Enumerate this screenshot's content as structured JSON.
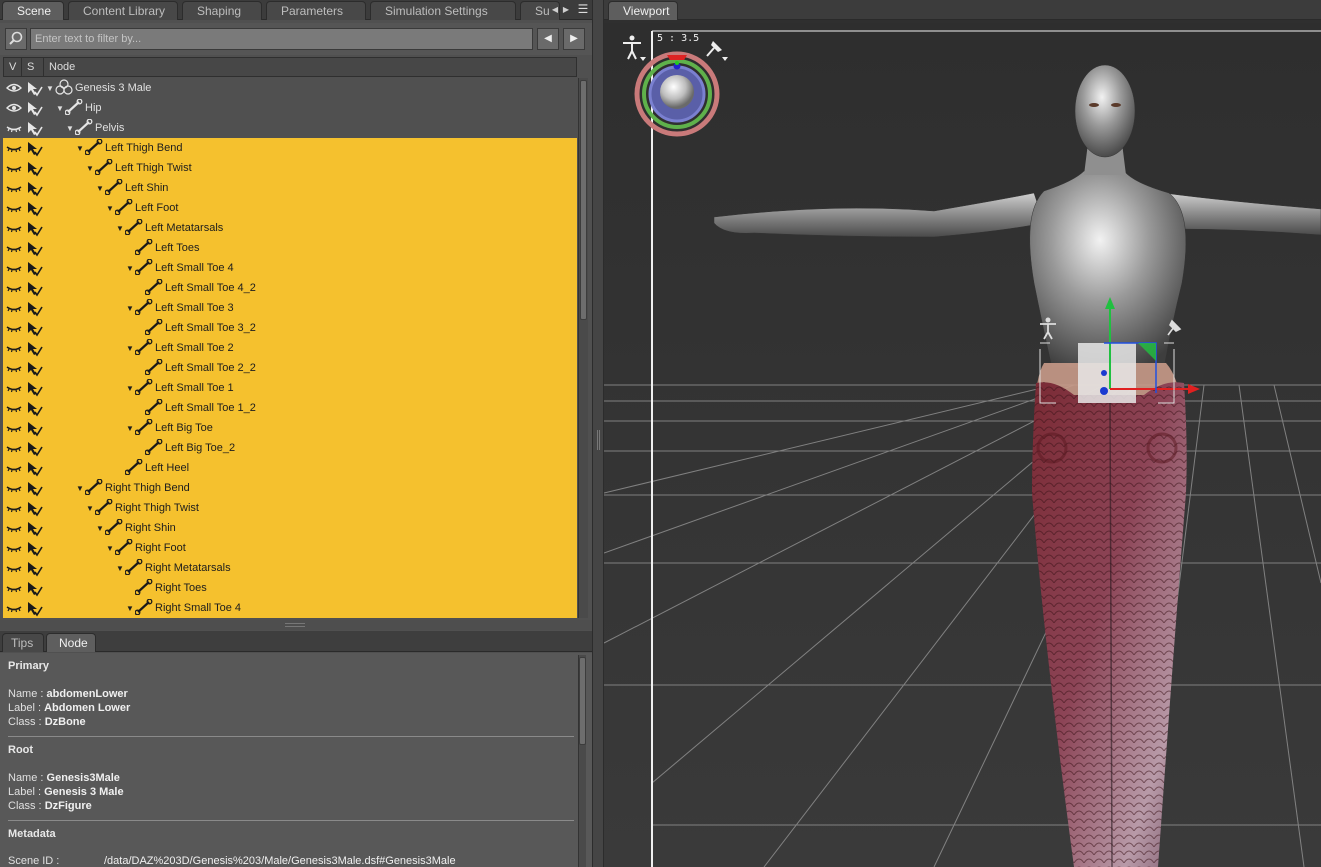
{
  "scene_tabs": [
    {
      "label": "Scene",
      "active": true
    },
    {
      "label": "Content Library",
      "active": false
    },
    {
      "label": "Shaping",
      "active": false
    },
    {
      "label": "Parameters",
      "active": false
    },
    {
      "label": "Simulation Settings",
      "active": false
    },
    {
      "label": "Su",
      "active": false
    }
  ],
  "filter": {
    "placeholder": "Enter text to filter by..."
  },
  "columns": {
    "v": "V",
    "s": "S",
    "node": "Node"
  },
  "tree_rows": [
    {
      "label": "Genesis 3 Male",
      "depth": 0,
      "expanded": true,
      "type": "figure",
      "selected": false,
      "visible": true
    },
    {
      "label": "Hip",
      "depth": 1,
      "expanded": true,
      "type": "bone",
      "selected": false,
      "visible": true
    },
    {
      "label": "Pelvis",
      "depth": 2,
      "expanded": true,
      "type": "bone",
      "selected": false,
      "visible": false
    },
    {
      "label": "Left Thigh Bend",
      "depth": 3,
      "expanded": true,
      "type": "bone",
      "selected": true,
      "visible": false
    },
    {
      "label": "Left Thigh Twist",
      "depth": 4,
      "expanded": true,
      "type": "bone",
      "selected": true,
      "visible": false
    },
    {
      "label": "Left Shin",
      "depth": 5,
      "expanded": true,
      "type": "bone",
      "selected": true,
      "visible": false
    },
    {
      "label": "Left Foot",
      "depth": 6,
      "expanded": true,
      "type": "bone",
      "selected": true,
      "visible": false
    },
    {
      "label": "Left Metatarsals",
      "depth": 7,
      "expanded": true,
      "type": "bone",
      "selected": true,
      "visible": false
    },
    {
      "label": "Left Toes",
      "depth": 8,
      "expanded": null,
      "type": "bone",
      "selected": true,
      "visible": false
    },
    {
      "label": "Left Small Toe 4",
      "depth": 8,
      "expanded": true,
      "type": "bone",
      "selected": true,
      "visible": false
    },
    {
      "label": "Left Small Toe 4_2",
      "depth": 9,
      "expanded": null,
      "type": "bone",
      "selected": true,
      "visible": false
    },
    {
      "label": "Left Small Toe 3",
      "depth": 8,
      "expanded": true,
      "type": "bone",
      "selected": true,
      "visible": false
    },
    {
      "label": "Left Small Toe 3_2",
      "depth": 9,
      "expanded": null,
      "type": "bone",
      "selected": true,
      "visible": false
    },
    {
      "label": "Left Small Toe 2",
      "depth": 8,
      "expanded": true,
      "type": "bone",
      "selected": true,
      "visible": false
    },
    {
      "label": "Left Small Toe 2_2",
      "depth": 9,
      "expanded": null,
      "type": "bone",
      "selected": true,
      "visible": false
    },
    {
      "label": "Left Small Toe 1",
      "depth": 8,
      "expanded": true,
      "type": "bone",
      "selected": true,
      "visible": false
    },
    {
      "label": "Left Small Toe 1_2",
      "depth": 9,
      "expanded": null,
      "type": "bone",
      "selected": true,
      "visible": false
    },
    {
      "label": "Left Big Toe",
      "depth": 8,
      "expanded": true,
      "type": "bone",
      "selected": true,
      "visible": false
    },
    {
      "label": "Left Big Toe_2",
      "depth": 9,
      "expanded": null,
      "type": "bone",
      "selected": true,
      "visible": false
    },
    {
      "label": "Left Heel",
      "depth": 7,
      "expanded": null,
      "type": "bone",
      "selected": true,
      "visible": false
    },
    {
      "label": "Right Thigh Bend",
      "depth": 3,
      "expanded": true,
      "type": "bone",
      "selected": true,
      "visible": false
    },
    {
      "label": "Right Thigh Twist",
      "depth": 4,
      "expanded": true,
      "type": "bone",
      "selected": true,
      "visible": false
    },
    {
      "label": "Right Shin",
      "depth": 5,
      "expanded": true,
      "type": "bone",
      "selected": true,
      "visible": false
    },
    {
      "label": "Right Foot",
      "depth": 6,
      "expanded": true,
      "type": "bone",
      "selected": true,
      "visible": false
    },
    {
      "label": "Right Metatarsals",
      "depth": 7,
      "expanded": true,
      "type": "bone",
      "selected": true,
      "visible": false
    },
    {
      "label": "Right Toes",
      "depth": 8,
      "expanded": null,
      "type": "bone",
      "selected": true,
      "visible": false
    },
    {
      "label": "Right Small Toe 4",
      "depth": 8,
      "expanded": true,
      "type": "bone",
      "selected": true,
      "visible": false
    }
  ],
  "bottom_tabs": [
    {
      "label": "Tips",
      "active": false
    },
    {
      "label": "Node",
      "active": true
    }
  ],
  "node_info": {
    "primary": {
      "heading": "Primary",
      "name_key": "Name :",
      "name": "abdomenLower",
      "label_key": "Label :",
      "label": "Abdomen Lower",
      "class_key": "Class :",
      "class": "DzBone"
    },
    "root": {
      "heading": "Root",
      "name_key": "Name :",
      "name": "Genesis3Male",
      "label_key": "Label :",
      "label": "Genesis 3 Male",
      "class_key": "Class :",
      "class": "DzFigure"
    },
    "metadata": {
      "heading": "Metadata",
      "scene_id_key": "Scene ID :",
      "scene_id": "/data/DAZ%203D/Genesis%203/Male/Genesis3Male.dsf#Genesis3Male"
    }
  },
  "viewport": {
    "tab": "Viewport",
    "aspect_ratio": "5 : 3.5"
  },
  "colors": {
    "selection": "#f5c12e",
    "panel": "#505050",
    "viewport_bg": "#333333"
  },
  "icons": [
    "search-icon",
    "arrow-left-icon",
    "arrow-right-icon",
    "panel-menu-icon",
    "eye-icon",
    "closed-eye-icon",
    "select-arrow-icon",
    "bone-icon",
    "figure-icon",
    "expand-arrow-icon",
    "pose-figure-icon",
    "pin-icon",
    "camera-orbit-icon",
    "transform-gizmo-icon"
  ]
}
